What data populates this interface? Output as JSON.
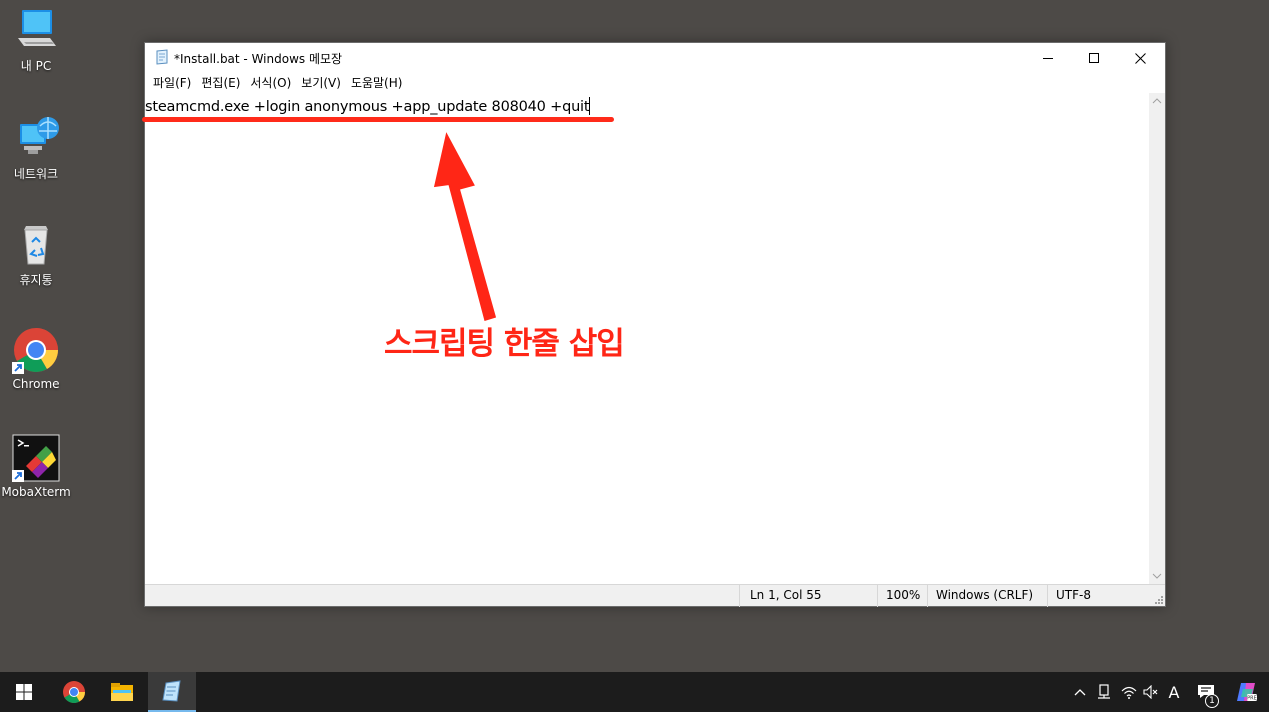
{
  "desktop": {
    "icons": [
      {
        "label": "내 PC",
        "icon": "computer-icon"
      },
      {
        "label": "네트워크",
        "icon": "network-icon"
      },
      {
        "label": "휴지통",
        "icon": "recycle-bin-icon"
      },
      {
        "label": "Chrome",
        "icon": "chrome-icon"
      },
      {
        "label": "MobaXterm",
        "icon": "mobaxterm-icon"
      }
    ]
  },
  "window": {
    "title": "*Install.bat - Windows 메모장",
    "menu": [
      "파일(F)",
      "편집(E)",
      "서식(O)",
      "보기(V)",
      "도움말(H)"
    ],
    "content": "steamcmd.exe +login anonymous +app_update 808040 +quit",
    "status": {
      "position": "Ln 1, Col 55",
      "zoom": "100%",
      "line_ending": "Windows (CRLF)",
      "encoding": "UTF-8"
    }
  },
  "annotation": {
    "text": "스크립팅 한줄 삽입",
    "color": "#ff2616"
  },
  "taskbar": {
    "apps": [
      "windows-start-icon",
      "chrome-icon",
      "file-explorer-icon",
      "notepad-icon"
    ],
    "tray": {
      "input_indicator": "A",
      "notification_count": "1"
    }
  }
}
